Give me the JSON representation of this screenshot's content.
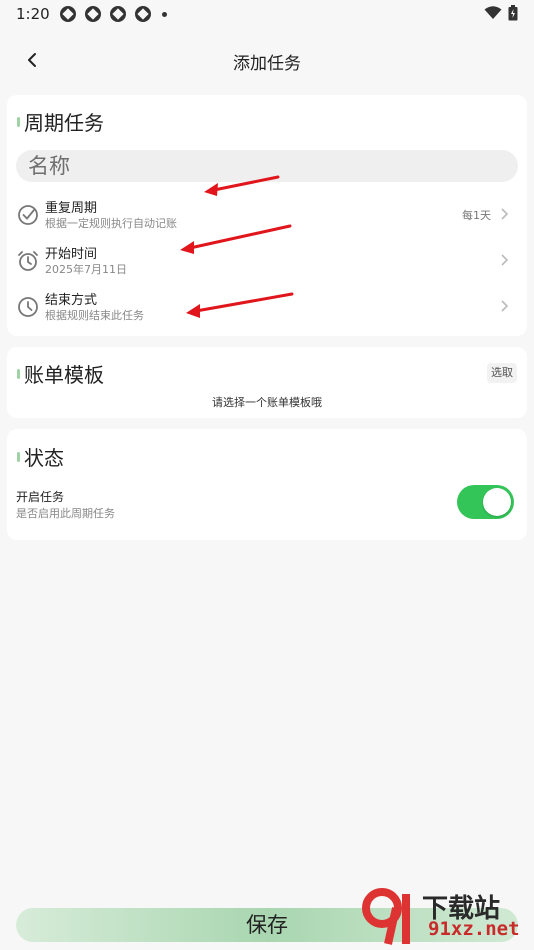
{
  "status_bar": {
    "time": "1:20"
  },
  "header": {
    "title": "添加任务"
  },
  "cycle_section": {
    "title": "周期任务",
    "name_placeholder": "名称",
    "rows": [
      {
        "title": "重复周期",
        "subtitle": "根据一定规则执行自动记账",
        "value": "每1天"
      },
      {
        "title": "开始时间",
        "subtitle": "2025年7月11日",
        "value": ""
      },
      {
        "title": "结束方式",
        "subtitle": "根据规则结束此任务",
        "value": ""
      }
    ]
  },
  "template_section": {
    "title": "账单模板",
    "pick_label": "选取",
    "hint": "请选择一个账单模板哦"
  },
  "status_section": {
    "title": "状态",
    "toggle_title": "开启任务",
    "toggle_subtitle": "是否启用此周期任务",
    "toggle_on": true
  },
  "save_label": "保存",
  "watermark": {
    "line1": "下载站",
    "line2": "91xz.net"
  },
  "colors": {
    "accent_green": "#34c559",
    "arrow_red": "#e0161c",
    "section_accent": "#9fd3a6"
  }
}
